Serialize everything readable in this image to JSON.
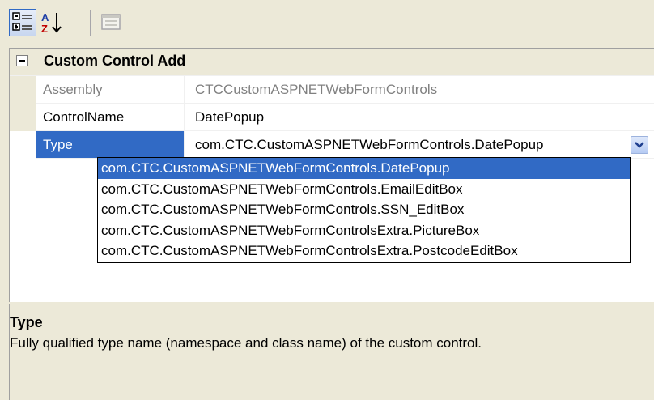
{
  "toolbar": {
    "buttons": [
      {
        "icon": "categorized-icon",
        "pressed": true
      },
      {
        "icon": "alphabetical-sort-icon",
        "pressed": false
      },
      {
        "icon": "property-pages-icon",
        "pressed": false,
        "disabled": true
      }
    ]
  },
  "category": {
    "label": "Custom Control Add",
    "expanded": true
  },
  "properties": [
    {
      "name": "Assembly",
      "value": "CTCCustomASPNETWebFormControls",
      "readonly": true
    },
    {
      "name": "ControlName",
      "value": "DatePopup",
      "readonly": false
    },
    {
      "name": "Type",
      "value": "com.CTC.CustomASPNETWebFormControls.DatePopup",
      "selected": true
    }
  ],
  "dropdown": {
    "options": [
      "com.CTC.CustomASPNETWebFormControls.DatePopup",
      "com.CTC.CustomASPNETWebFormControls.EmailEditBox",
      "com.CTC.CustomASPNETWebFormControls.SSN_EditBox",
      "com.CTC.CustomASPNETWebFormControlsExtra.PictureBox",
      "com.CTC.CustomASPNETWebFormControlsExtra.PostcodeEditBox"
    ],
    "selected_index": 0
  },
  "description": {
    "title": "Type",
    "text": "Fully qualified type name (namespace and class name) of the custom control."
  },
  "colors": {
    "selection": "#316ac5",
    "background": "#ece9d8",
    "muted_text": "#808080"
  }
}
